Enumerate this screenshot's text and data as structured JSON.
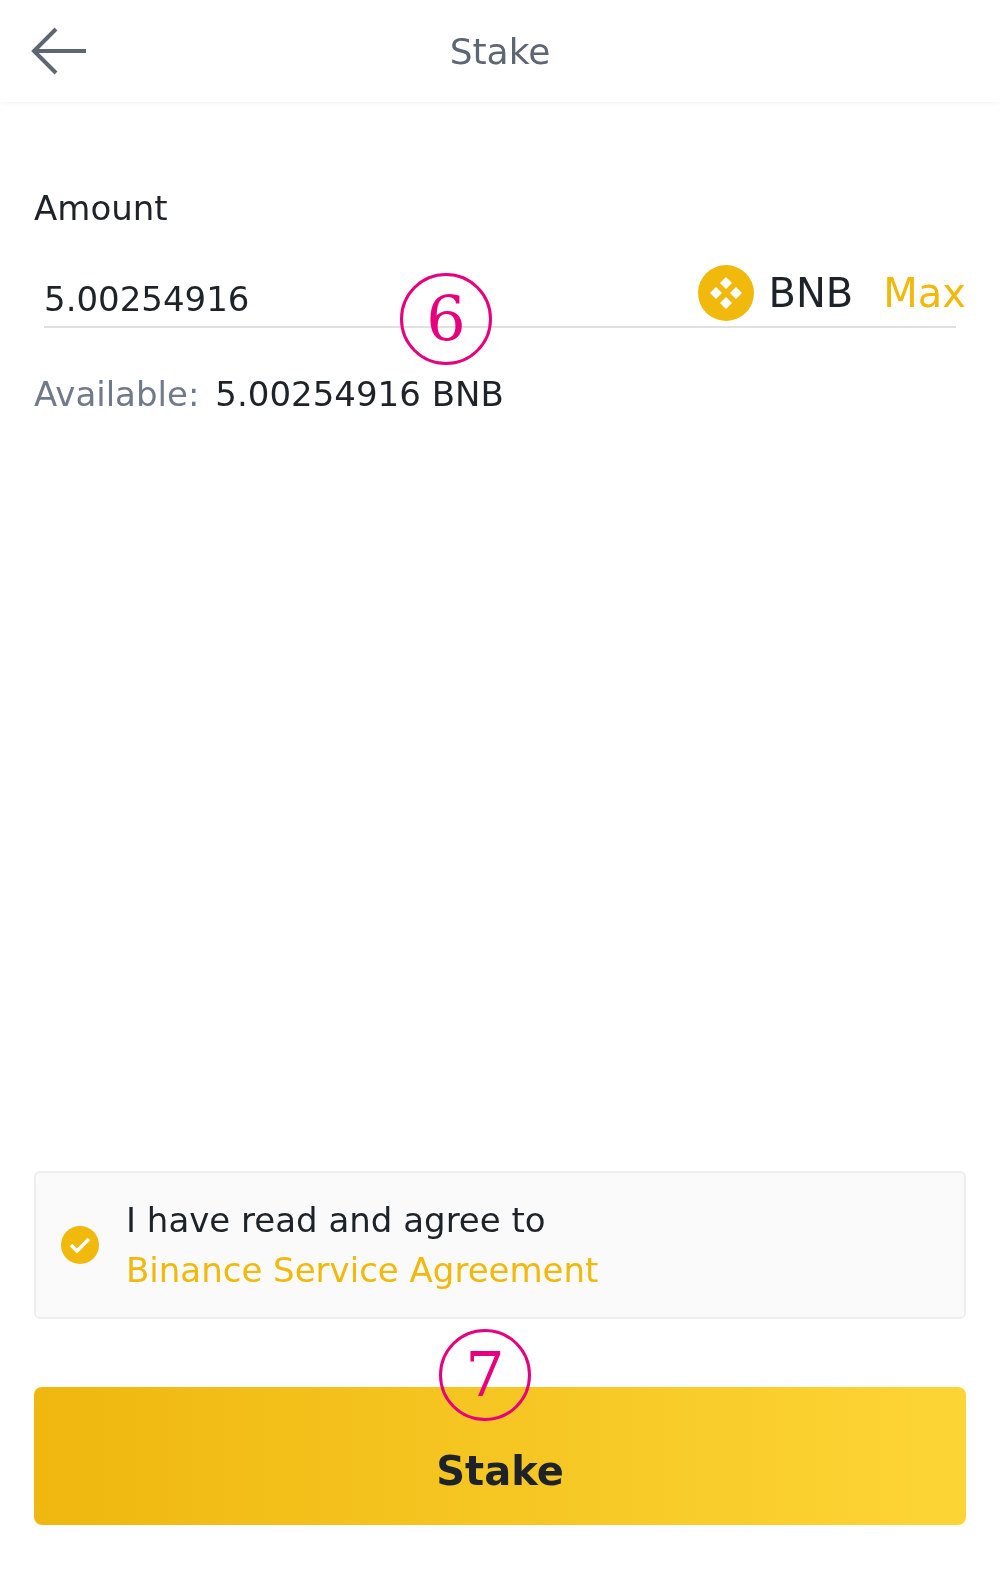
{
  "header": {
    "title": "Stake"
  },
  "amount": {
    "label": "Amount",
    "value": "5.00254916",
    "currency": "BNB",
    "max": "Max"
  },
  "available": {
    "label": "Available:",
    "value": "5.00254916 BNB"
  },
  "agreement": {
    "checked": true,
    "text": "I have read and agree to ",
    "link": "Binance Service Agreement"
  },
  "button": {
    "label": "Stake"
  },
  "annotations": [
    {
      "label": "6"
    },
    {
      "label": "7"
    }
  ]
}
